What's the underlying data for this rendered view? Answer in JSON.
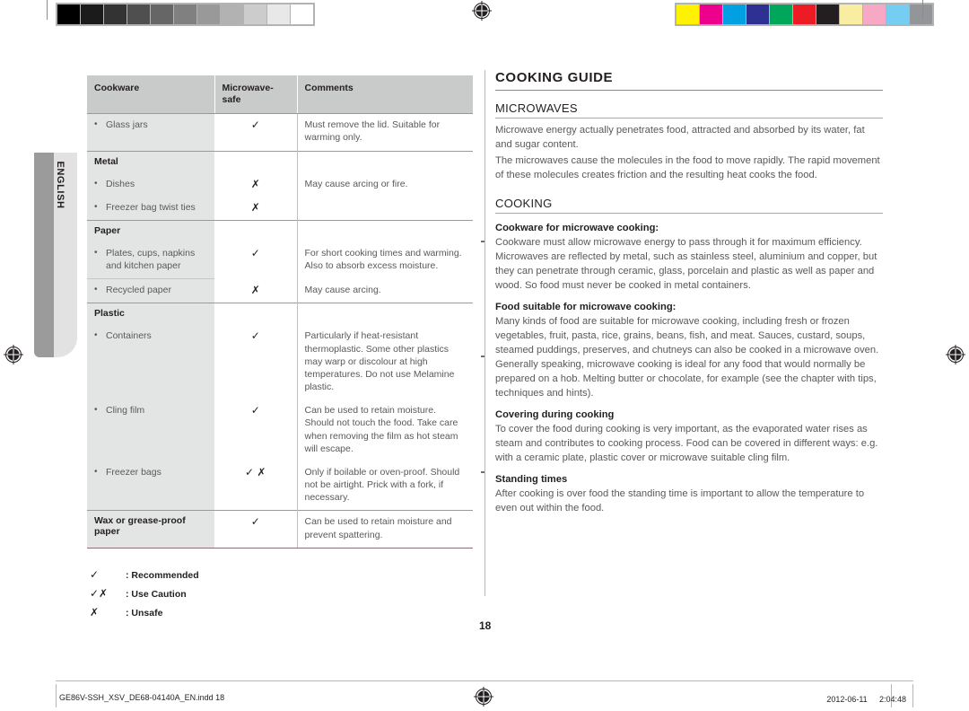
{
  "page": {
    "number": "18",
    "language_tab": "ENGLISH"
  },
  "calibration": {
    "gray_bar": [
      "#000000",
      "#1b1b1b",
      "#333333",
      "#4f4f4f",
      "#666666",
      "#808080",
      "#999999",
      "#b2b2b2",
      "#cccccc",
      "#e8e8e8",
      "#ffffff"
    ],
    "color_bar": [
      "#fff200",
      "#ec008c",
      "#00a0e3",
      "#2e3192",
      "#00a65a",
      "#ed1c24",
      "#231f20",
      "#f9eda1",
      "#f6a8c4",
      "#76cdf2",
      "#939598"
    ]
  },
  "table": {
    "headers": [
      "Cookware",
      "Microwave-\nsafe",
      "Comments"
    ],
    "header_col1": "Cookware",
    "header_col2_line1": "Microwave-",
    "header_col2_line2": "safe",
    "header_col3": "Comments",
    "groups": [
      {
        "title": null,
        "rows": [
          {
            "item": "Glass jars",
            "bulleted": true,
            "symbol": "✓",
            "comment": "Must remove the lid. Suitable for warming only."
          }
        ]
      },
      {
        "title": "Metal",
        "rows": [
          {
            "item": "Dishes",
            "bulleted": true,
            "symbol": "✗",
            "comment": "May cause arcing or fire."
          },
          {
            "item": "Freezer bag twist ties",
            "bulleted": true,
            "symbol": "✗",
            "comment": ""
          }
        ]
      },
      {
        "title": "Paper",
        "rows": [
          {
            "item": "Plates, cups, napkins and kitchen paper",
            "bulleted": true,
            "symbol": "✓",
            "comment": "For short cooking times and warming. Also to absorb excess moisture."
          },
          {
            "item": "Recycled paper",
            "bulleted": true,
            "symbol": "✗",
            "comment": "May cause arcing."
          }
        ]
      },
      {
        "title": "Plastic",
        "rows": [
          {
            "item": "Containers",
            "bulleted": true,
            "symbol": "✓",
            "comment": "Particularly if heat-resistant thermoplastic. Some other plastics may warp or discolour at high temperatures. Do not use Melamine plastic."
          },
          {
            "item": "Cling film",
            "bulleted": true,
            "symbol": "✓",
            "comment": "Can be used to retain moisture. Should not touch the food. Take care when removing the film as hot steam will escape."
          },
          {
            "item": "Freezer bags",
            "bulleted": true,
            "symbol": "✓ ✗",
            "comment": "Only if boilable or oven-proof. Should not be airtight. Prick with a fork, if necessary."
          }
        ]
      },
      {
        "title": "Wax or grease-proof paper",
        "title_is_row": true,
        "rows": [
          {
            "item": "Wax or grease-proof paper",
            "bulleted": false,
            "bold": true,
            "symbol": "✓",
            "comment": "Can be used to retain moisture and prevent spattering."
          }
        ]
      }
    ]
  },
  "legend": [
    {
      "symbol": "✓",
      "label": ": Recommended"
    },
    {
      "symbol": "✓✗",
      "label": ": Use Caution"
    },
    {
      "symbol": "✗",
      "label": ": Unsafe"
    }
  ],
  "guide": {
    "title": "COOKING GUIDE",
    "sections": [
      {
        "heading": "MICROWAVES",
        "paragraphs": [
          "Microwave energy actually penetrates food, attracted and absorbed by its water, fat and sugar content.",
          "The microwaves cause the molecules in the food to move rapidly. The rapid movement of these molecules creates friction and the resulting heat cooks the food."
        ]
      },
      {
        "heading": "COOKING",
        "blocks": [
          {
            "sub_heading": "Cookware for microwave cooking:",
            "text": "Cookware must allow microwave energy to pass through it for maximum efficiency. Microwaves are reflected by metal, such as stainless steel, aluminium and copper, but they can penetrate through ceramic, glass, porcelain and plastic as well as paper and wood. So food must never be cooked in metal containers."
          },
          {
            "sub_heading": "Food suitable for microwave cooking:",
            "text": "Many kinds of food are suitable for microwave cooking, including fresh or frozen vegetables, fruit, pasta, rice, grains, beans, fish, and meat. Sauces, custard, soups, steamed puddings, preserves, and chutneys can also be cooked in a microwave oven. Generally speaking, microwave cooking is ideal for any food that would normally be prepared on a hob. Melting butter or chocolate, for example (see the chapter with tips, techniques and hints)."
          },
          {
            "sub_heading": "Covering during cooking",
            "text": "To cover the food during cooking is very important, as the evaporated water rises as steam and contributes to cooking process. Food can be covered in different ways: e.g. with a ceramic plate, plastic cover or microwave suitable cling film."
          },
          {
            "sub_heading": "Standing times",
            "text": "After cooking is over food the standing time is important to allow the temperature to even out within the food."
          }
        ]
      }
    ]
  },
  "footer": {
    "file_name": "GE86V-SSH_XSV_DE68-04140A_EN.indd   18",
    "timestamp": "2012-06-11   ᅟ 2:04:48"
  }
}
